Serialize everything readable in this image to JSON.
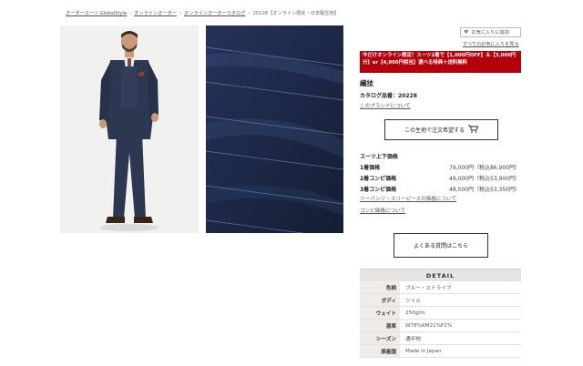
{
  "breadcrumb": {
    "items": [
      "オーダースーツ GlobalStyle",
      "オンラインオーダー",
      "オンラインオーダーカタログ",
      "20228【オンライン限定・日本製生地】"
    ]
  },
  "favorites": {
    "add_label": "お気に入りに追加",
    "view_all_label": "すべてのお気に入りを見る"
  },
  "promo": {
    "text": "今だけオンライン限定！スーツ2着で【1,000円OFF】＆【3,000円分】or【4,000円相当】選べる特典＋送料無料"
  },
  "product": {
    "brand": "繊技",
    "catalog_label": "カタログ品番：20228",
    "brand_link": "このブランドについて",
    "order_button": "この生地で注文希望する"
  },
  "pricing": {
    "title": "スーツ上下価格",
    "rows": [
      {
        "label": "1着価格",
        "price": "79,000円（税込86,900円）"
      },
      {
        "label": "2着コンビ価格",
        "price": "49,000円（税込53,900円）"
      },
      {
        "label": "3着コンビ価格",
        "price": "48,500円（税込53,350円）"
      }
    ],
    "links": [
      "ツーパンツ・スリーピースの価格について",
      "コンビ価格について"
    ]
  },
  "faq_button": "よくある質問はこちら",
  "detail": {
    "heading": "DETAIL",
    "rows": [
      {
        "key": "色柄",
        "value": "ブルー・ストライプ"
      },
      {
        "key": "ボディ",
        "value": "ツイル"
      },
      {
        "key": "ウェイト",
        "value": "250g/m"
      },
      {
        "key": "混率",
        "value": "W78%KM21%P1%"
      },
      {
        "key": "シーズン",
        "value": "通年物"
      },
      {
        "key": "原産国",
        "value": "Made in Japan"
      }
    ]
  },
  "colors": {
    "promo_bg": "#b3000c",
    "fabric_navy": "#1e2a4a",
    "suit_navy": "#2c3752",
    "detail_header_bg": "#e8e4e2"
  },
  "icons": {
    "favorite": "heart-icon",
    "order": "cart-icon"
  }
}
